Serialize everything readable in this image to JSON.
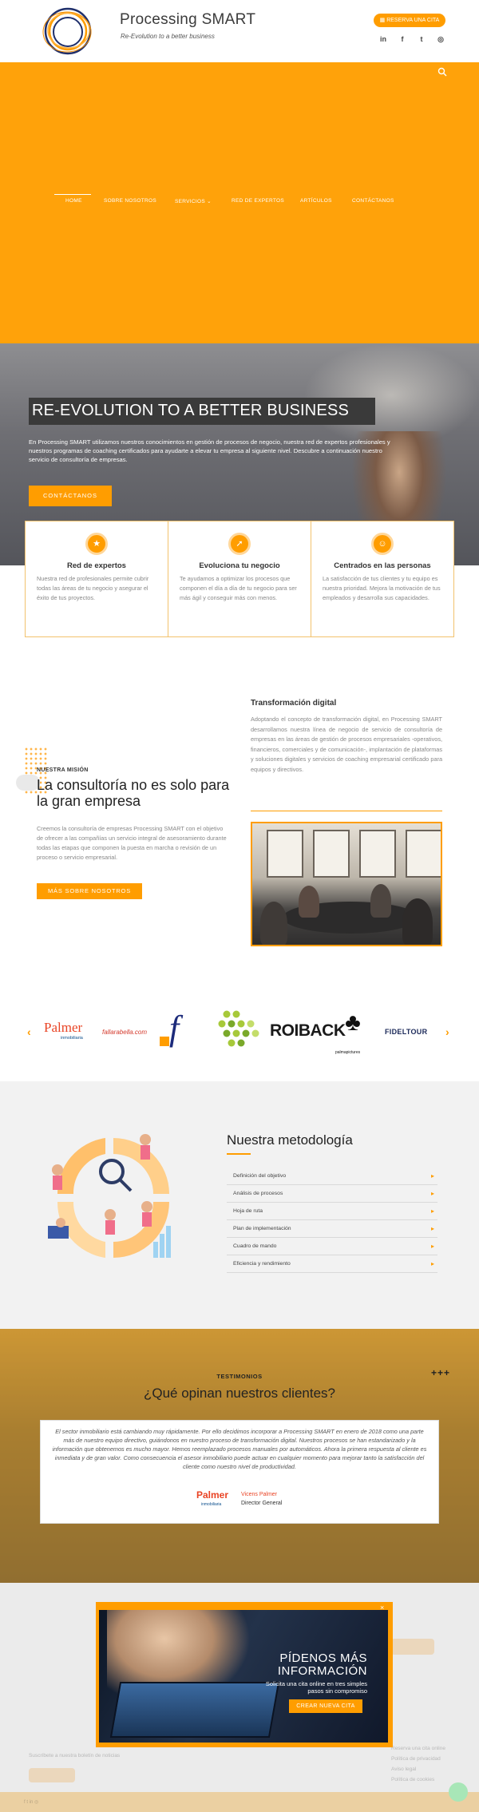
{
  "header": {
    "brand": "Processing SMART",
    "tagline": "Re-Evolution to a better business",
    "cta": "RESERVA UNA CITA",
    "socials": [
      "linkedin-icon",
      "facebook-icon",
      "twitter-icon",
      "instagram-icon"
    ]
  },
  "nav": {
    "items": [
      "HOME",
      "SOBRE NOSOTROS",
      "SERVICIOS",
      "RED DE EXPERTOS",
      "ARTÍCULOS",
      "CONTÁCTANOS"
    ],
    "active": "HOME"
  },
  "hero": {
    "title": "RE-EVOLUTION TO A BETTER BUSINESS",
    "text": "En Processing SMART utilizamos nuestros conocimientos en gestión de procesos de negocio, nuestra red de expertos profesionales y nuestros programas de coaching certificados para ayudarte a elevar tu empresa al siguiente nivel. Descubre a continuación nuestro servicio de consultoría de empresas.",
    "button": "CONTÁCTANOS"
  },
  "features": [
    {
      "icon": "star-icon",
      "title": "Red de expertos",
      "text": "Nuestra red de profesionales permite cubrir todas las áreas de tu negocio y asegurar el éxito de tus proyectos."
    },
    {
      "icon": "rocket-icon",
      "title": "Evoluciona tu negocio",
      "text": "Te ayudamos a optimizar los procesos que componen el día a día de tu negocio para ser más ágil y conseguir más con menos."
    },
    {
      "icon": "people-icon",
      "title": "Centrados en las personas",
      "text": "La satisfacción de tus clientes y tu equipo es nuestra prioridad. Mejora la motivación de tus empleados y desarrolla sus capacidades."
    }
  ],
  "mission": {
    "kicker": "NUESTRA MISIÓN",
    "title": "La consultoría no es solo para la gran empresa",
    "text": "Creemos la consultoría de empresas Processing SMART con el objetivo de ofrecer a las compañías un servicio integral de asesoramiento durante todas las etapas que componen la puesta en marcha o revisión de un proceso o servicio empresarial.",
    "button": "MÁS SOBRE NOSOTROS"
  },
  "digital": {
    "title": "Transformación digital",
    "text": "Adoptando el concepto de transformación digital, en Processing SMART desarrollamos nuestra línea de negocio de servicio de consultoría de empresas en las áreas de gestión de procesos empresariales -operativos, financieros, comerciales y de comunicación-, implantación de plataformas y soluciones digitales y servicios de coaching empresarial certificado para equipos y directivos."
  },
  "clients": {
    "logos": [
      "Palmer",
      "inmobiliaria",
      "fallarabella.com",
      "f",
      "ROIBACK",
      "palmapictures",
      "FIDELTOUR"
    ],
    "prev": "‹",
    "next": "›"
  },
  "method": {
    "title": "Nuestra metodología",
    "items": [
      "Definición del objetivo",
      "Análisis de procesos",
      "Hoja de ruta",
      "Plan de implementación",
      "Cuadro de mando",
      "Eficiencia y rendimiento"
    ]
  },
  "testimonials": {
    "kicker": "TESTIMONIOS",
    "title": "¿Qué opinan nuestros clientes?",
    "quote": "El sector inmobiliario está cambiando muy rápidamente. Por ello decidimos incorporar a Processing SMART en enero de 2018 como una parte más de nuestro equipo directivo, guiándonos en nuestro proceso de transformación digital. Nuestros procesos se han estandarizado y la información que obtenemos es mucho mayor. Hemos reemplazado procesos manuales por automáticos. Ahora la primera respuesta al cliente es inmediata y de gran valor. Como consecuencia el asesor inmobiliario puede actuar en cualquier momento para mejorar tanto la satisfacción del cliente como nuestro nivel de productividad.",
    "logo": "Palmer",
    "logo_sub": "inmobiliaria",
    "name": "Vicens Palmer",
    "role": "Director General"
  },
  "modal": {
    "title": "PÍDENOS MÁS INFORMACIÓN",
    "text": "Solicita una cita online en tres simples pasos sin compromiso",
    "button": "CREAR NUEVA CITA",
    "close": "×"
  },
  "footer_ghost": {
    "subscribe": "Suscríbete a nuestra boletín de noticias",
    "links": [
      "Reserva una cita online",
      "Política de privacidad",
      "Aviso legal",
      "Política de cookies"
    ]
  },
  "colors": {
    "accent": "#ff9d00",
    "nav_band": "#ffa20a",
    "dark_text": "#222222"
  }
}
